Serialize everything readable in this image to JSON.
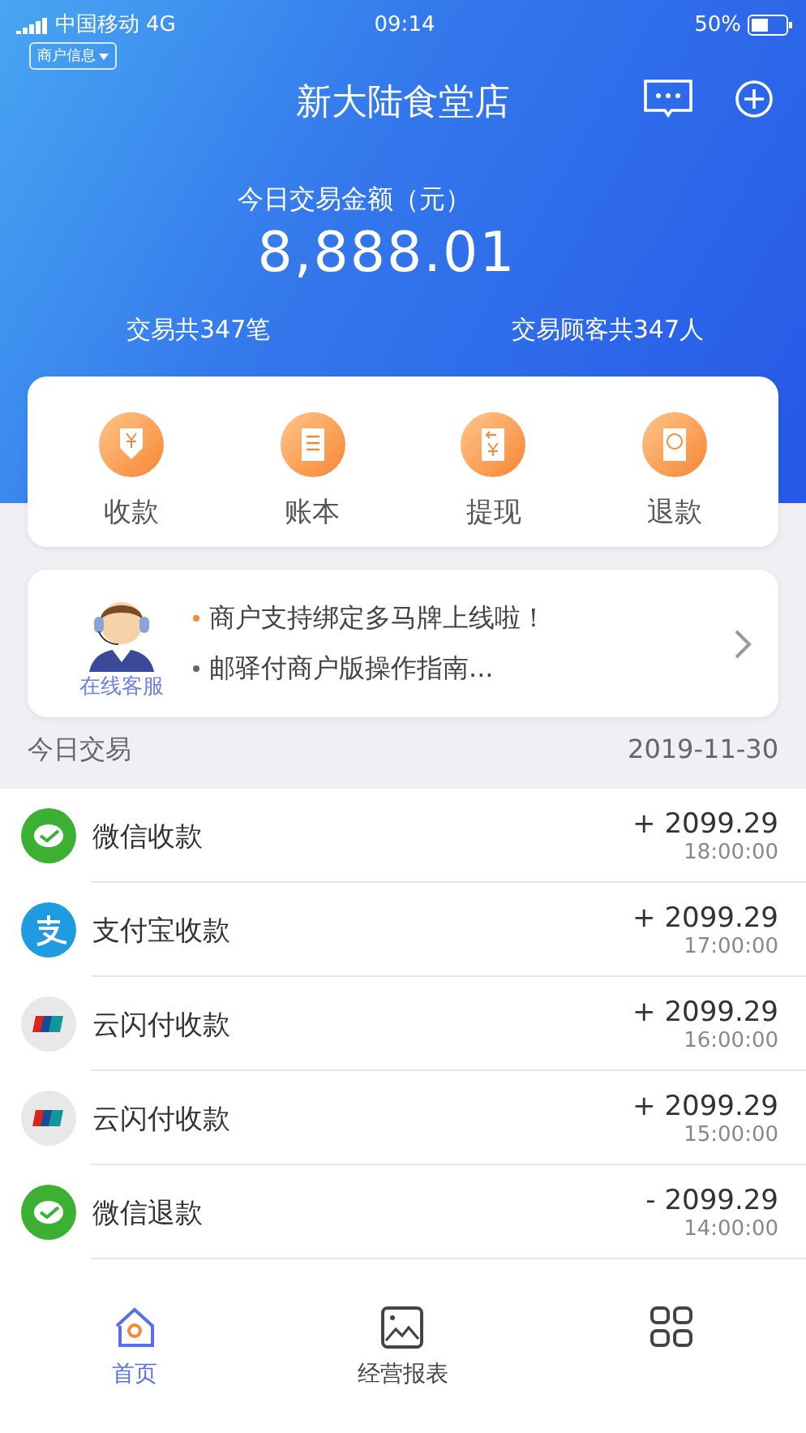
{
  "status_bar": {
    "carrier": "中国移动",
    "network": "4G",
    "time": "09:14",
    "battery": "50%"
  },
  "header": {
    "merchant_chip": "商户信息",
    "title": "新大陆食堂店"
  },
  "summary": {
    "label": "今日交易金额（元）",
    "amount": "8,888.01",
    "count": "交易共347笔",
    "customers": "交易顾客共347人"
  },
  "actions": [
    {
      "kind": "receive",
      "label": "收款"
    },
    {
      "kind": "ledger",
      "label": "账本"
    },
    {
      "kind": "withdraw",
      "label": "提现"
    },
    {
      "kind": "refund",
      "label": "退款"
    }
  ],
  "notice": {
    "service_label": "在线客服",
    "lines": [
      {
        "text": "商户支持绑定多马牌上线啦！",
        "highlighted": true
      },
      {
        "text": "邮驿付商户版操作指南...",
        "highlighted": false
      }
    ]
  },
  "transactions": {
    "title": "今日交易",
    "date": "2019-11-30",
    "rows": [
      {
        "kind": "wechat",
        "name": "微信收款",
        "amount": "+ 2099.29",
        "time": "18:00:00"
      },
      {
        "kind": "alipay",
        "name": "支付宝收款",
        "amount": "+ 2099.29",
        "time": "17:00:00"
      },
      {
        "kind": "unionpay",
        "name": "云闪付收款",
        "amount": "+ 2099.29",
        "time": "16:00:00"
      },
      {
        "kind": "unionpay",
        "name": "云闪付收款",
        "amount": "+ 2099.29",
        "time": "15:00:00"
      },
      {
        "kind": "wechat",
        "name": "微信退款",
        "amount": "- 2099.29",
        "time": "14:00:00"
      }
    ]
  },
  "tab_bar": [
    {
      "kind": "home",
      "label": "首页",
      "selected": true
    },
    {
      "kind": "report",
      "label": "经营报表",
      "selected": false
    },
    {
      "kind": "grid",
      "selected": false
    }
  ]
}
